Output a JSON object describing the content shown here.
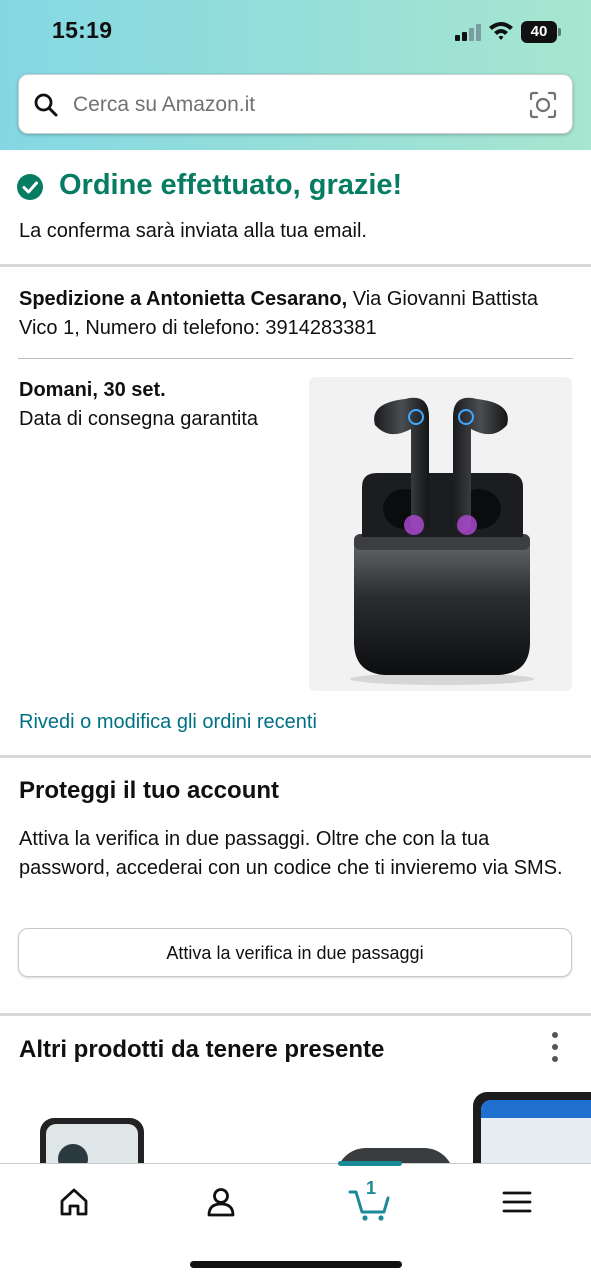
{
  "status_bar": {
    "time": "15:19",
    "battery": "40"
  },
  "search": {
    "placeholder": "Cerca su Amazon.it"
  },
  "confirmation": {
    "title": "Ordine effettuato, grazie!",
    "subtitle": "La conferma sarà inviata alla tua email."
  },
  "shipping": {
    "recipient_label": "Spedizione a Antonietta Cesarano,",
    "address": " Via Giovanni Battista Vico 1, Numero di telefono: 3914283381"
  },
  "delivery": {
    "date": "Domani, 30 set.",
    "guarantee": "Data di consegna garantita"
  },
  "orders_link": "Rivedi o modifica gli ordini recenti",
  "protect": {
    "title": "Proteggi il tuo account",
    "text": "Attiva la verifica in due passaggi. Oltre che con la tua password, accederai con un codice che ti invieremo via SMS.",
    "button": "Attiva la verifica in due passaggi"
  },
  "more_products": {
    "title": "Altri prodotti da tenere presente"
  },
  "nav": {
    "cart_count": "1"
  },
  "colors": {
    "success": "#067d62",
    "link": "#007185",
    "accent": "#1b8a98"
  }
}
